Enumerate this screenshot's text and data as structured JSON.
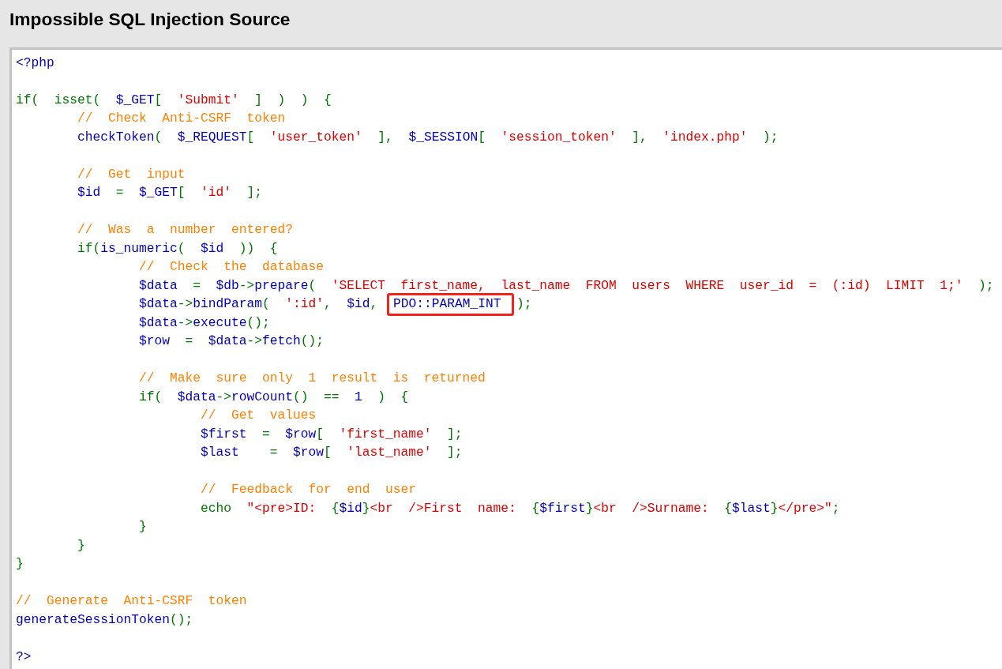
{
  "header": {
    "title": "Impossible SQL Injection Source"
  },
  "source": {
    "lines": [
      {
        "kind": "code",
        "tokens": [
          {
            "text": "<?php",
            "kind": "default"
          }
        ]
      },
      {
        "kind": "blank"
      },
      {
        "kind": "code",
        "tokens": [
          {
            "text": "if( isset( ",
            "kind": "keyword"
          },
          {
            "text": "$_GET",
            "kind": "default"
          },
          {
            "text": "[ ",
            "kind": "keyword"
          },
          {
            "text": "'Submit'",
            "kind": "string"
          },
          {
            "text": " ] ) ) {",
            "kind": "keyword"
          }
        ],
        "children": [
          {
            "kind": "code",
            "tokens": [
              {
                "text": "// Check Anti-CSRF token",
                "kind": "comment"
              }
            ]
          },
          {
            "kind": "code",
            "tokens": [
              {
                "text": "checkToken",
                "kind": "default"
              },
              {
                "text": "( ",
                "kind": "keyword"
              },
              {
                "text": "$_REQUEST",
                "kind": "default"
              },
              {
                "text": "[ ",
                "kind": "keyword"
              },
              {
                "text": "'user_token'",
                "kind": "string"
              },
              {
                "text": " ], ",
                "kind": "keyword"
              },
              {
                "text": "$_SESSION",
                "kind": "default"
              },
              {
                "text": "[ ",
                "kind": "keyword"
              },
              {
                "text": "'session_token'",
                "kind": "string"
              },
              {
                "text": " ], ",
                "kind": "keyword"
              },
              {
                "text": "'index.php'",
                "kind": "string"
              },
              {
                "text": " );",
                "kind": "keyword"
              }
            ]
          },
          {
            "kind": "blank"
          },
          {
            "kind": "code",
            "tokens": [
              {
                "text": "// Get input",
                "kind": "comment"
              }
            ]
          },
          {
            "kind": "code",
            "tokens": [
              {
                "text": "$id ",
                "kind": "default"
              },
              {
                "text": "= ",
                "kind": "keyword"
              },
              {
                "text": "$_GET",
                "kind": "default"
              },
              {
                "text": "[ ",
                "kind": "keyword"
              },
              {
                "text": "'id'",
                "kind": "string"
              },
              {
                "text": " ];",
                "kind": "keyword"
              }
            ]
          },
          {
            "kind": "blank"
          },
          {
            "kind": "code",
            "tokens": [
              {
                "text": "// Was a number entered?",
                "kind": "comment"
              }
            ]
          },
          {
            "kind": "code",
            "tokens": [
              {
                "text": "if(",
                "kind": "keyword"
              },
              {
                "text": "is_numeric",
                "kind": "default"
              },
              {
                "text": "( ",
                "kind": "keyword"
              },
              {
                "text": "$id ",
                "kind": "default"
              },
              {
                "text": ")) {",
                "kind": "keyword"
              }
            ],
            "children": [
              {
                "kind": "code",
                "tokens": [
                  {
                    "text": "// Check the database",
                    "kind": "comment"
                  }
                ]
              },
              {
                "kind": "code",
                "tokens": [
                  {
                    "text": "$data ",
                    "kind": "default"
                  },
                  {
                    "text": "= ",
                    "kind": "keyword"
                  },
                  {
                    "text": "$db",
                    "kind": "default"
                  },
                  {
                    "text": "->",
                    "kind": "keyword"
                  },
                  {
                    "text": "prepare",
                    "kind": "default"
                  },
                  {
                    "text": "( ",
                    "kind": "keyword"
                  },
                  {
                    "text": "'SELECT first_name, last_name FROM users WHERE user_id = (:id) LIMIT 1;'",
                    "kind": "string"
                  },
                  {
                    "text": " );",
                    "kind": "keyword"
                  }
                ]
              },
              {
                "kind": "code",
                "tokens": [
                  {
                    "text": "$data",
                    "kind": "default"
                  },
                  {
                    "text": "->",
                    "kind": "keyword"
                  },
                  {
                    "text": "bindParam",
                    "kind": "default"
                  },
                  {
                    "text": "( ",
                    "kind": "keyword"
                  },
                  {
                    "text": "':id'",
                    "kind": "string"
                  },
                  {
                    "text": ", ",
                    "kind": "keyword"
                  },
                  {
                    "text": "$id",
                    "kind": "default"
                  },
                  {
                    "text": ", ",
                    "kind": "keyword"
                  },
                  {
                    "text": "PDO::PARAM_INT",
                    "kind": "default",
                    "boxed": true
                  },
                  {
                    "text": " );",
                    "kind": "keyword"
                  }
                ]
              },
              {
                "kind": "code",
                "tokens": [
                  {
                    "text": "$data",
                    "kind": "default"
                  },
                  {
                    "text": "->",
                    "kind": "keyword"
                  },
                  {
                    "text": "execute",
                    "kind": "default"
                  },
                  {
                    "text": "();",
                    "kind": "keyword"
                  }
                ]
              },
              {
                "kind": "code",
                "tokens": [
                  {
                    "text": "$row ",
                    "kind": "default"
                  },
                  {
                    "text": "= ",
                    "kind": "keyword"
                  },
                  {
                    "text": "$data",
                    "kind": "default"
                  },
                  {
                    "text": "->",
                    "kind": "keyword"
                  },
                  {
                    "text": "fetch",
                    "kind": "default"
                  },
                  {
                    "text": "();",
                    "kind": "keyword"
                  }
                ]
              },
              {
                "kind": "blank"
              },
              {
                "kind": "code",
                "tokens": [
                  {
                    "text": "// Make sure only 1 result is returned",
                    "kind": "comment"
                  }
                ]
              },
              {
                "kind": "code",
                "tokens": [
                  {
                    "text": "if( ",
                    "kind": "keyword"
                  },
                  {
                    "text": "$data",
                    "kind": "default"
                  },
                  {
                    "text": "->",
                    "kind": "keyword"
                  },
                  {
                    "text": "rowCount",
                    "kind": "default"
                  },
                  {
                    "text": "() == ",
                    "kind": "keyword"
                  },
                  {
                    "text": "1 ",
                    "kind": "default"
                  },
                  {
                    "text": ") {",
                    "kind": "keyword"
                  }
                ],
                "children": [
                  {
                    "kind": "code",
                    "tokens": [
                      {
                        "text": "// Get values",
                        "kind": "comment"
                      }
                    ]
                  },
                  {
                    "kind": "code",
                    "tokens": [
                      {
                        "text": "$first ",
                        "kind": "default"
                      },
                      {
                        "text": "= ",
                        "kind": "keyword"
                      },
                      {
                        "text": "$row",
                        "kind": "default"
                      },
                      {
                        "text": "[ ",
                        "kind": "keyword"
                      },
                      {
                        "text": "'first_name'",
                        "kind": "string"
                      },
                      {
                        "text": " ];",
                        "kind": "keyword"
                      }
                    ]
                  },
                  {
                    "kind": "code",
                    "tokens": [
                      {
                        "text": "$last  ",
                        "kind": "default"
                      },
                      {
                        "text": "= ",
                        "kind": "keyword"
                      },
                      {
                        "text": "$row",
                        "kind": "default"
                      },
                      {
                        "text": "[ ",
                        "kind": "keyword"
                      },
                      {
                        "text": "'last_name'",
                        "kind": "string"
                      },
                      {
                        "text": " ];",
                        "kind": "keyword"
                      }
                    ]
                  },
                  {
                    "kind": "blank"
                  },
                  {
                    "kind": "code",
                    "tokens": [
                      {
                        "text": "// Feedback for end user",
                        "kind": "comment"
                      }
                    ]
                  },
                  {
                    "kind": "code",
                    "tokens": [
                      {
                        "text": "echo ",
                        "kind": "keyword"
                      },
                      {
                        "text": "\"<pre>ID: ",
                        "kind": "string"
                      },
                      {
                        "text": "{",
                        "kind": "keyword"
                      },
                      {
                        "text": "$id",
                        "kind": "default"
                      },
                      {
                        "text": "}",
                        "kind": "keyword"
                      },
                      {
                        "text": "<br />First name: ",
                        "kind": "string"
                      },
                      {
                        "text": "{",
                        "kind": "keyword"
                      },
                      {
                        "text": "$first",
                        "kind": "default"
                      },
                      {
                        "text": "}",
                        "kind": "keyword"
                      },
                      {
                        "text": "<br />Surname: ",
                        "kind": "string"
                      },
                      {
                        "text": "{",
                        "kind": "keyword"
                      },
                      {
                        "text": "$last",
                        "kind": "default"
                      },
                      {
                        "text": "}",
                        "kind": "keyword"
                      },
                      {
                        "text": "</pre>\"",
                        "kind": "string"
                      },
                      {
                        "text": ";",
                        "kind": "keyword"
                      }
                    ]
                  }
                ]
              },
              {
                "kind": "code",
                "tokens": [
                  {
                    "text": "}",
                    "kind": "keyword"
                  }
                ]
              }
            ]
          },
          {
            "kind": "code",
            "tokens": [
              {
                "text": "}",
                "kind": "keyword"
              }
            ]
          }
        ]
      },
      {
        "kind": "code",
        "tokens": [
          {
            "text": "}",
            "kind": "keyword"
          }
        ]
      },
      {
        "kind": "blank"
      },
      {
        "kind": "code",
        "tokens": [
          {
            "text": "// Generate Anti-CSRF token",
            "kind": "comment"
          }
        ]
      },
      {
        "kind": "code",
        "tokens": [
          {
            "text": "generateSessionToken",
            "kind": "default"
          },
          {
            "text": "();",
            "kind": "keyword"
          }
        ]
      },
      {
        "kind": "blank"
      },
      {
        "kind": "code",
        "tokens": [
          {
            "text": "?>",
            "kind": "default"
          }
        ]
      }
    ]
  }
}
